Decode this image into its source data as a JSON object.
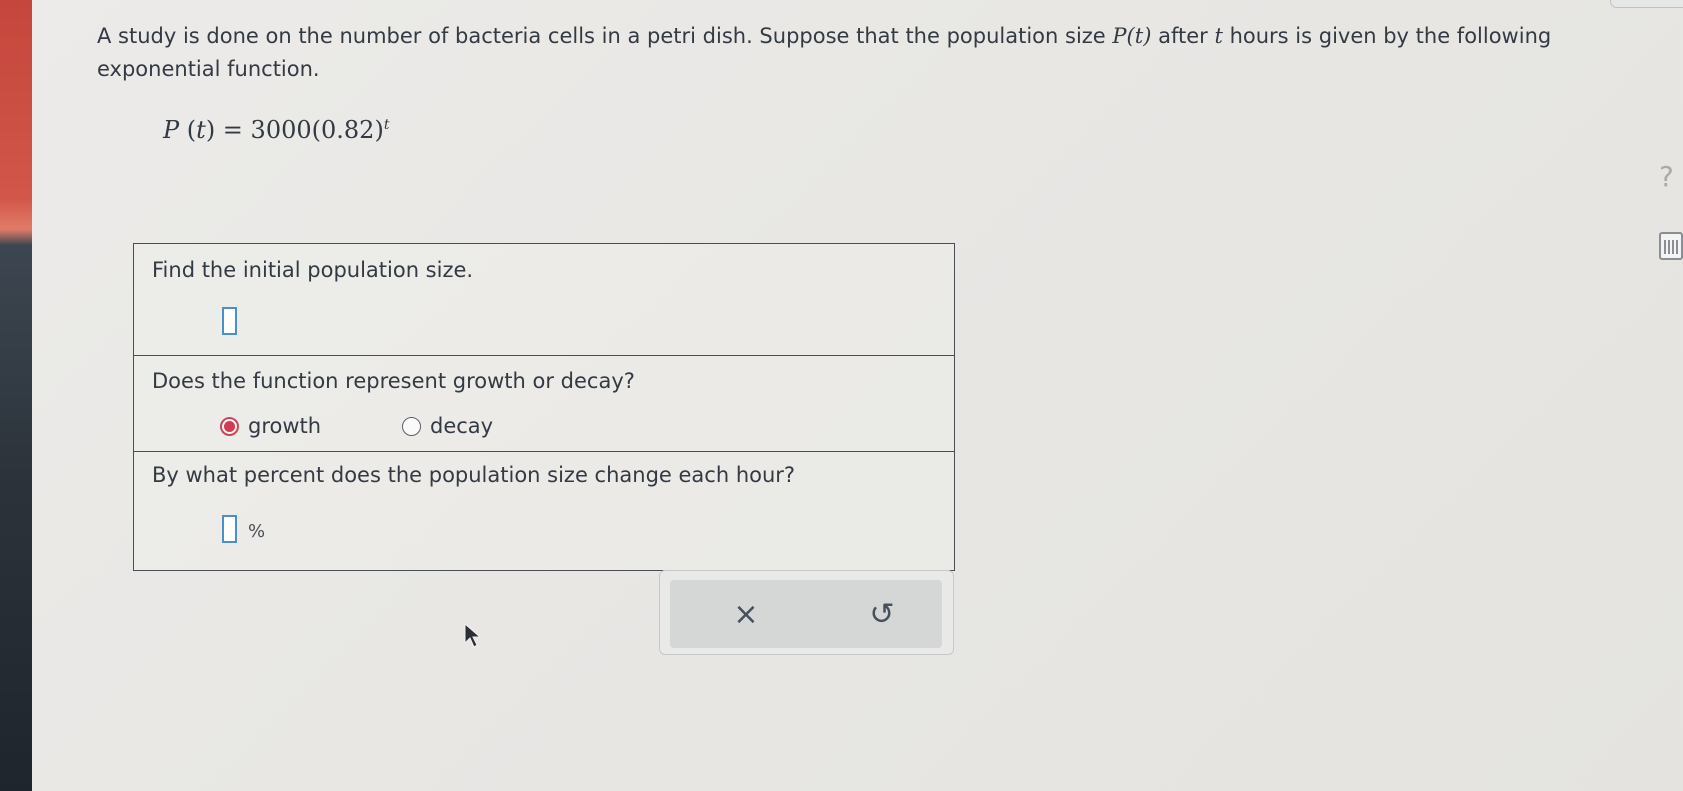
{
  "problem": {
    "sentence_part1": "A study is done on the number of bacteria cells in a petri dish. Suppose that the population size ",
    "func_name": "P",
    "func_arg": "t",
    "sentence_part2": " after ",
    "var": "t",
    "sentence_part3": " hours is given by the following exponential function."
  },
  "formula": {
    "lhs_name": "P",
    "lhs_arg": "t",
    "rhs_coefficient": "3000",
    "rhs_base": "0.82",
    "exponent": "t"
  },
  "questions": {
    "q1": {
      "text": "Find the initial population size.",
      "answer_value": ""
    },
    "q2": {
      "text": "Does the function represent growth or decay?",
      "options": [
        {
          "label": "growth",
          "selected": true
        },
        {
          "label": "decay",
          "selected": false
        }
      ]
    },
    "q3": {
      "text": "By what percent does the population size change each hour?",
      "answer_value": "",
      "unit": "%"
    }
  },
  "actions": {
    "clear_symbol": "×",
    "undo_symbol": "↺"
  },
  "side_tools": {
    "help_symbol": "?"
  },
  "colors": {
    "input_border": "#4a8fc6",
    "radio_selected": "#d43a50",
    "panel_bg": "#d5d6d6"
  }
}
